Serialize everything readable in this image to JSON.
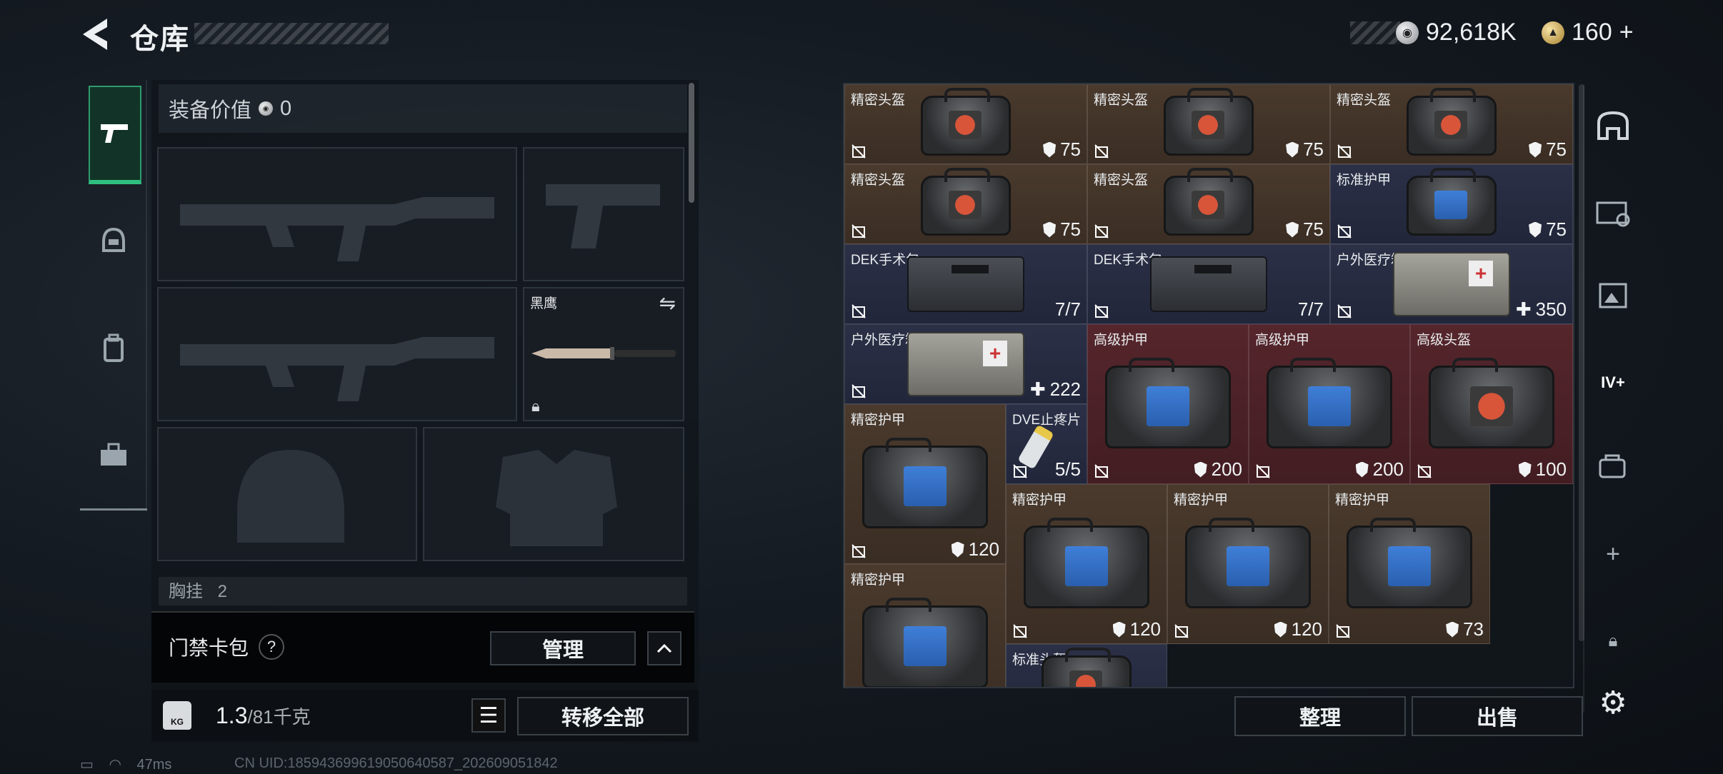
{
  "header": {
    "title": "仓库",
    "currency_silver": "92,618K",
    "currency_gold": "160",
    "gold_plus": "+"
  },
  "left_tabs": [
    {
      "icon": "pistol-icon",
      "active": true
    },
    {
      "icon": "helmet-icon",
      "active": false
    },
    {
      "icon": "backpack-icon",
      "active": false
    },
    {
      "icon": "toolbox-icon",
      "active": false
    }
  ],
  "equipment": {
    "value_label": "装备价值",
    "value": "0",
    "knife_name": "黑鹰",
    "chest_label": "胸挂",
    "chest_count": "2"
  },
  "keycard": {
    "label": "门禁卡包",
    "help": "?",
    "manage_label": "管理"
  },
  "weight": {
    "icon_label": "KG",
    "current": "1.3",
    "max": "/81千克",
    "transfer_all_label": "转移全部"
  },
  "grid_items": [
    {
      "name": "精密头盔",
      "value": "75",
      "kind": "shield",
      "color": "brown",
      "art": "helmet"
    },
    {
      "name": "精密头盔",
      "value": "75",
      "kind": "shield",
      "color": "brown",
      "art": "helmet"
    },
    {
      "name": "精密头盔",
      "value": "75",
      "kind": "shield",
      "color": "brown",
      "art": "helmet"
    },
    {
      "name": "精密头盔",
      "value": "75",
      "kind": "shield",
      "color": "brown",
      "art": "helmet"
    },
    {
      "name": "精密头盔",
      "value": "75",
      "kind": "shield",
      "color": "brown",
      "art": "helmet"
    },
    {
      "name": "标准护甲",
      "value": "75",
      "kind": "shield",
      "color": "blue",
      "art": "armor"
    },
    {
      "name": "DEK手术包",
      "value": "7/7",
      "kind": "count",
      "color": "blue",
      "art": "medkit"
    },
    {
      "name": "DEK手术包",
      "value": "7/7",
      "kind": "count",
      "color": "blue",
      "art": "medkit"
    },
    {
      "name": "户外医疗箱",
      "value": "350",
      "kind": "plus",
      "color": "blue",
      "art": "box"
    },
    {
      "name": "户外医疗箱",
      "value": "222",
      "kind": "plus",
      "color": "blue",
      "art": "box"
    },
    {
      "name": "高级护甲",
      "value": "200",
      "kind": "shield",
      "color": "red",
      "art": "armor"
    },
    {
      "name": "高级护甲",
      "value": "200",
      "kind": "shield",
      "color": "red",
      "art": "armor"
    },
    {
      "name": "高级头盔",
      "value": "100",
      "kind": "shield",
      "color": "red",
      "art": "helmet"
    },
    {
      "name": "精密护甲",
      "value": "120",
      "kind": "shield",
      "color": "brown",
      "art": "armor"
    },
    {
      "name": "DVE止疼片",
      "value": "5/5",
      "kind": "count",
      "color": "blue",
      "art": "spray"
    },
    {
      "name": "精密护甲",
      "value": "120",
      "kind": "shield",
      "color": "brown",
      "art": "armor"
    },
    {
      "name": "精密护甲",
      "value": "120",
      "kind": "shield",
      "color": "brown",
      "art": "armor"
    },
    {
      "name": "精密护甲",
      "value": "73",
      "kind": "shield",
      "color": "brown",
      "art": "armor"
    },
    {
      "name": "精密护甲",
      "value": "",
      "kind": "none",
      "color": "brown",
      "art": "armor"
    },
    {
      "name": "标准头盔",
      "value": "",
      "kind": "none",
      "color": "blue",
      "art": "helmet"
    }
  ],
  "actions": {
    "organize_label": "整理",
    "sell_label": "出售"
  },
  "side_icons": [
    "stash-icon",
    "ticket-icon",
    "image-frame-icon",
    "add-slot-icon",
    "bag-icon",
    "plus-icon",
    "lock-icon",
    "settings-icon"
  ],
  "status": {
    "ping": "47ms",
    "uid": "CN UID:185943699619050640587_202609051842"
  },
  "colors": {
    "brown": "#4a3a2d",
    "blue": "#2b3047",
    "red": "#55262c",
    "accent_green": "#2fbf7e"
  }
}
